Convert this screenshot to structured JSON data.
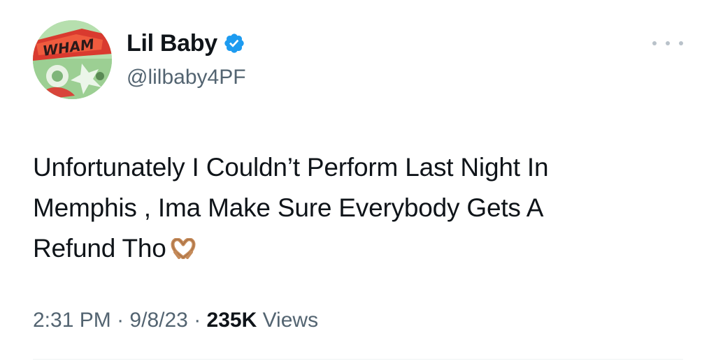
{
  "author": {
    "display_name": "Lil Baby",
    "handle": "@lilbaby4PF",
    "avatar_text": "WHAM",
    "verified_color": "#1d9bf0"
  },
  "tweet": {
    "text_lines": [
      "Unfortunately I Couldn’t Perform Last Night In",
      "Memphis , Ima Make Sure Everybody Gets A",
      "Refund Tho"
    ],
    "emoji": "heart-hands"
  },
  "meta": {
    "time": "2:31 PM",
    "separator": "·",
    "date": "9/8/23",
    "views_count": "235K",
    "views_label": "Views"
  },
  "icons": {
    "more": "more-horizontal-icon",
    "verified": "verified-badge-icon"
  },
  "colors": {
    "text_primary": "#0f1419",
    "text_secondary": "#536471",
    "divider": "#eff3f4"
  }
}
